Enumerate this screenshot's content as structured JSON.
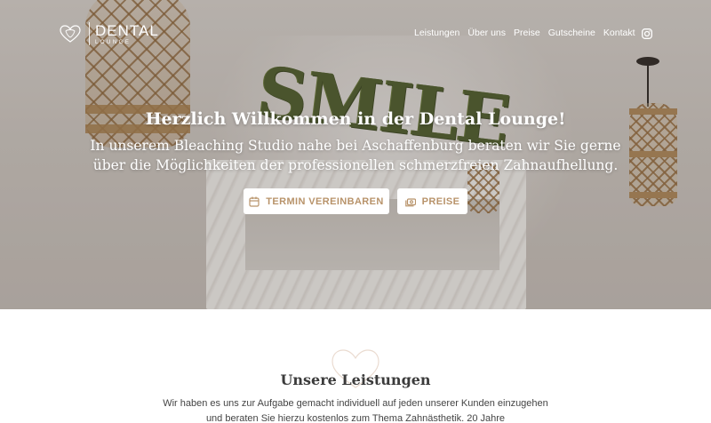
{
  "brand": {
    "logo_title": "DENTAL",
    "logo_subtitle": "LOUNGE",
    "accent_color": "#b8936a"
  },
  "nav": {
    "items": [
      "Leistungen",
      "Über uns",
      "Preise",
      "Gutscheine",
      "Kontakt"
    ],
    "social_icon": "instagram-icon"
  },
  "hero": {
    "title": "Herzlich Willkommen in der Dental Lounge!",
    "subtitle": "In unserem Bleaching Studio nahe bei Aschaffenburg beraten wir Sie gerne über die Möglichkeiten der professionellen schmerzfreien Zahnaufhellung.",
    "background_sign": "SMILE",
    "buttons": [
      {
        "label": "TERMIN VEREINBAREN",
        "icon": "calendar-icon"
      },
      {
        "label": "PREISE",
        "icon": "money-icon"
      }
    ]
  },
  "services": {
    "title": "Unsere Leistungen",
    "text": "Wir haben es uns zur Aufgabe gemacht individuell auf jeden unserer Kunden einzugehen und beraten Sie hierzu kostenlos zum Thema Zahnästhetik. 20 Jahre"
  }
}
